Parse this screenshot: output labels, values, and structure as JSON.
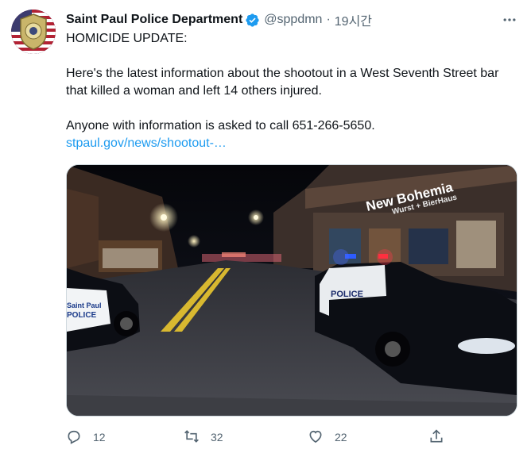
{
  "author": {
    "display_name": "Saint Paul Police Department",
    "handle": "@sppdmn",
    "separator": "·",
    "time_ago": "19시간"
  },
  "tweet": {
    "line1": "HOMICIDE UPDATE:",
    "line2": "Here's the latest information about the shootout in a West Seventh Street bar that killed a woman and left 14 others injured.",
    "line3": "Anyone with information is asked to call 651-266-5650.",
    "link_text": "stpaul.gov/news/shootout-…"
  },
  "photo": {
    "sign_text_1": "New Bohemia",
    "sign_text_2": "Wurst + BierHaus",
    "police_text": "POLICE",
    "police_left_text": "Saint Paul",
    "police_left_text2": "POLICE"
  },
  "actions": {
    "reply_count": "12",
    "retweet_count": "32",
    "like_count": "22"
  },
  "colors": {
    "link": "#1d9bf0",
    "verified": "#1d9bf0",
    "muted": "#536471"
  },
  "icons": [
    "verified-badge-icon",
    "more-icon",
    "reply-icon",
    "retweet-icon",
    "like-icon",
    "share-icon"
  ]
}
